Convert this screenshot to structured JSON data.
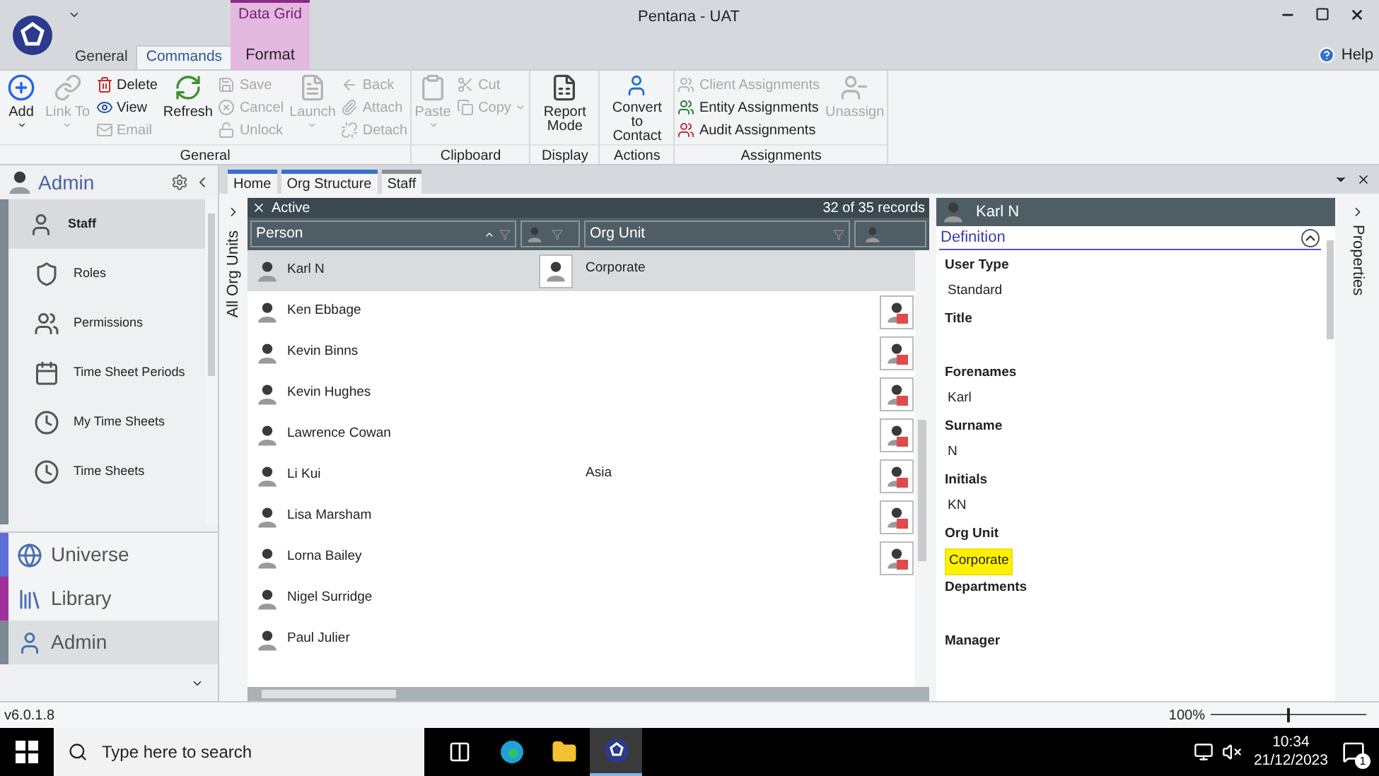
{
  "window": {
    "title": "Pentana - UAT"
  },
  "ribbon_tabs": [
    {
      "label": "General",
      "selected": false
    },
    {
      "label": "Commands",
      "selected": true
    }
  ],
  "context_tab": {
    "group": "Data Grid",
    "label": "Format",
    "selected": false
  },
  "help": "Help",
  "ribbon_groups": [
    {
      "label": "General",
      "columns": [
        {
          "kind": "large",
          "label": "Add",
          "dropdown": true,
          "disabled": false
        },
        {
          "kind": "large",
          "label": "Link To",
          "dropdown": true,
          "disabled": true
        },
        {
          "kind": "small",
          "items": [
            {
              "label": "Delete",
              "disabled": false
            },
            {
              "label": "View",
              "disabled": false
            },
            {
              "label": "Email",
              "disabled": true
            }
          ]
        },
        {
          "kind": "large",
          "label": "Refresh",
          "dropdown": false,
          "disabled": false
        },
        {
          "kind": "small",
          "items": [
            {
              "label": "Save",
              "disabled": true
            },
            {
              "label": "Cancel",
              "disabled": true
            },
            {
              "label": "Unlock",
              "disabled": true
            }
          ]
        },
        {
          "kind": "large",
          "label": "Launch",
          "dropdown": true,
          "disabled": true
        },
        {
          "kind": "small",
          "items": [
            {
              "label": "Back",
              "disabled": true
            },
            {
              "label": "Attach",
              "disabled": true
            },
            {
              "label": "Detach",
              "disabled": true
            }
          ]
        }
      ]
    },
    {
      "label": "Clipboard",
      "columns": [
        {
          "kind": "large",
          "label": "Paste",
          "dropdown": true,
          "disabled": true
        },
        {
          "kind": "small",
          "items": [
            {
              "label": "Cut",
              "disabled": true,
              "dropdown": false
            },
            {
              "label": "Copy",
              "disabled": true,
              "dropdown": true
            }
          ]
        }
      ]
    },
    {
      "label": "Display",
      "columns": [
        {
          "kind": "large",
          "label": "Report Mode",
          "dropdown": false,
          "disabled": false
        }
      ]
    },
    {
      "label": "Actions",
      "columns": [
        {
          "kind": "large",
          "label": "Convert to Contact",
          "dropdown": false,
          "disabled": false
        }
      ]
    },
    {
      "label": "Assignments",
      "columns": [
        {
          "kind": "small",
          "items": [
            {
              "label": "Client Assignments",
              "disabled": true
            },
            {
              "label": "Entity Assignments",
              "disabled": false
            },
            {
              "label": "Audit Assignments",
              "disabled": false
            }
          ]
        },
        {
          "kind": "large",
          "label": "Unassign",
          "dropdown": false,
          "disabled": true
        }
      ]
    }
  ],
  "sidebar": {
    "title": "Admin",
    "items": [
      {
        "label": "Staff",
        "selected": true
      },
      {
        "label": "Roles",
        "selected": false
      },
      {
        "label": "Permissions",
        "selected": false
      },
      {
        "label": "Time Sheet Periods",
        "selected": false
      },
      {
        "label": "My Time Sheets",
        "selected": false
      },
      {
        "label": "Time Sheets",
        "selected": false
      }
    ],
    "sections": [
      {
        "label": "Universe",
        "color": "#5b6fd6",
        "selected": false
      },
      {
        "label": "Library",
        "color": "#a0309c",
        "selected": false
      },
      {
        "label": "Admin",
        "color": "#7d8a92",
        "selected": true
      }
    ]
  },
  "doc_tabs": [
    {
      "label": "Home",
      "selected": false
    },
    {
      "label": "Org Structure",
      "selected": false
    },
    {
      "label": "Staff",
      "selected": true
    }
  ],
  "side_strip": {
    "label": "All Org Units"
  },
  "grid": {
    "filter": "Active",
    "records": "32 of 35 records",
    "columns": [
      "Person",
      "Org Unit"
    ],
    "rows": [
      {
        "person": "Karl N",
        "org_unit": "Corporate",
        "selected": true,
        "role_icon": false
      },
      {
        "person": "Ken Ebbage",
        "selected": false,
        "role_icon": true
      },
      {
        "person": "Kevin Binns",
        "selected": false,
        "role_icon": true
      },
      {
        "person": "Kevin Hughes",
        "selected": false,
        "role_icon": true
      },
      {
        "person": "Lawrence Cowan",
        "selected": false,
        "role_icon": true
      },
      {
        "person": "Li Kui",
        "org_unit": "Asia",
        "selected": false,
        "role_icon": true
      },
      {
        "person": "Lisa Marsham",
        "selected": false,
        "role_icon": true
      },
      {
        "person": "Lorna Bailey",
        "selected": false,
        "role_icon": true
      },
      {
        "person": "Nigel Surridge",
        "selected": false,
        "role_icon": false
      },
      {
        "person": "Paul Julier",
        "selected": false,
        "role_icon": false
      }
    ]
  },
  "details": {
    "title": "Karl N",
    "section": "Definition",
    "fields": [
      {
        "label": "User Type",
        "value": "Standard",
        "highlighted": false
      },
      {
        "label": "Title"
      },
      {
        "label": "Forenames",
        "value": "Karl",
        "highlighted": false
      },
      {
        "label": "Surname",
        "value": "N",
        "highlighted": false
      },
      {
        "label": "Initials",
        "value": "KN",
        "highlighted": false
      },
      {
        "label": "Org Unit",
        "value": "Corporate",
        "highlighted": true
      },
      {
        "label": "Departments"
      },
      {
        "label": "Manager"
      }
    ],
    "strip": "Properties"
  },
  "status_bar": {
    "version": "v6.0.1.8",
    "zoom": {
      "reading": "100%",
      "level": 0.5
    }
  },
  "taskbar": {
    "search_placeholder": "Type here to search",
    "apps": [
      {
        "active": false
      },
      {
        "active": false
      },
      {
        "active": false
      },
      {
        "active": true
      }
    ],
    "time": "10:34",
    "date": "21/12/2023",
    "notifications": "1"
  }
}
